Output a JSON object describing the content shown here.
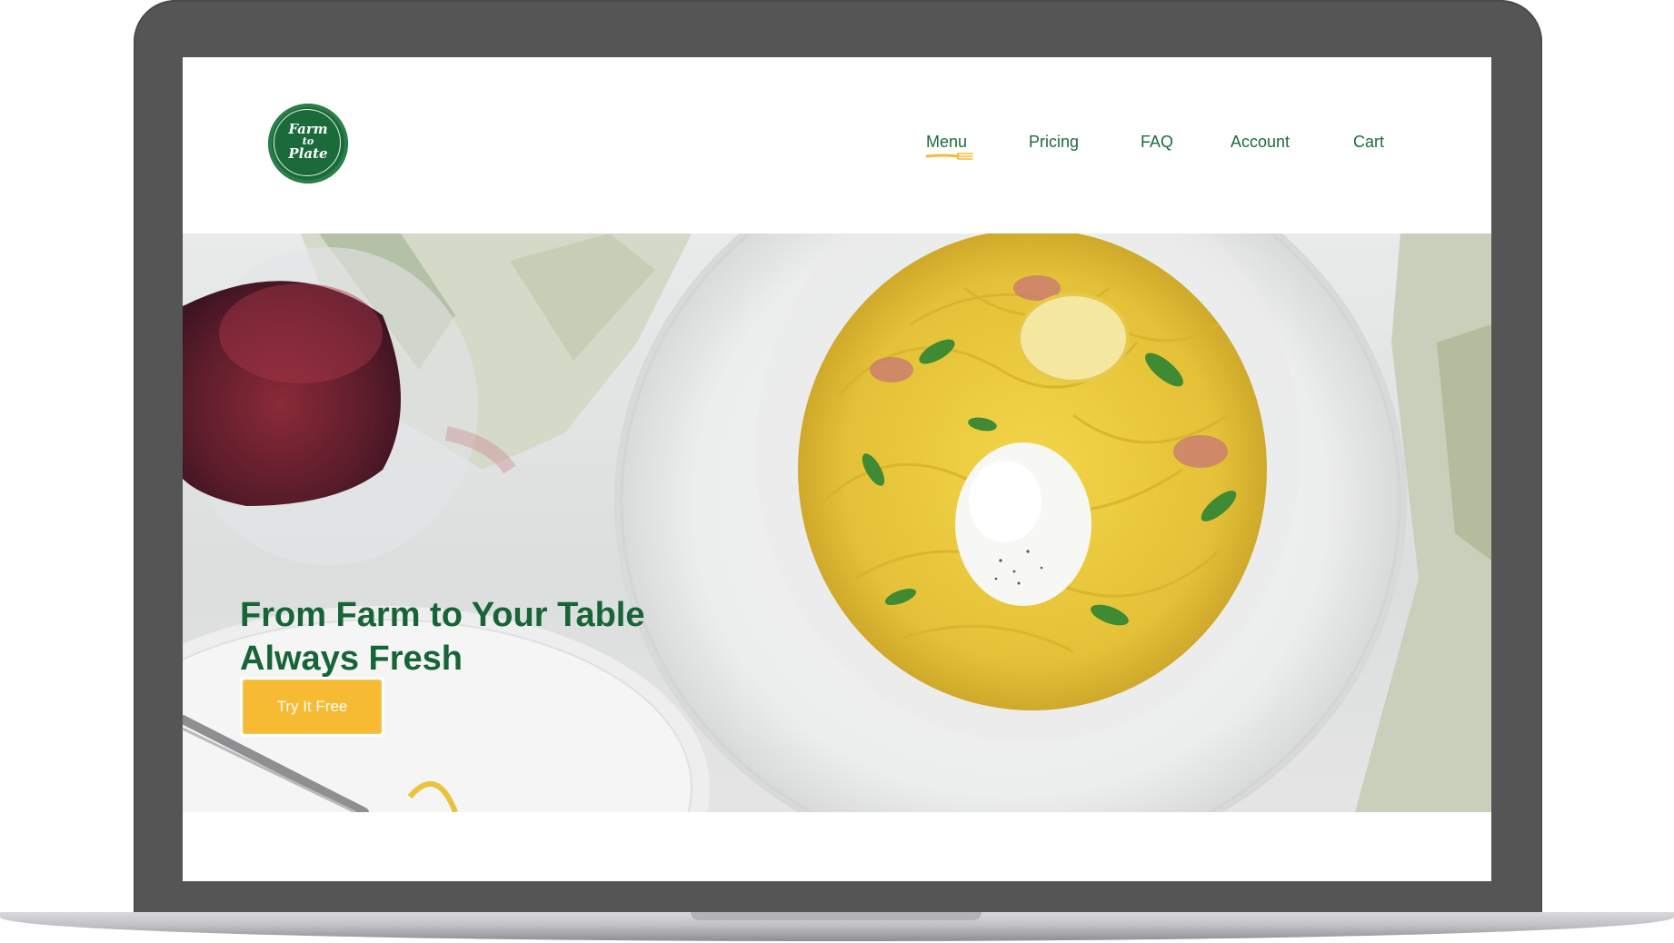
{
  "brand": {
    "logo_line1": "Farm",
    "logo_line2": "to",
    "logo_line3": "Plate",
    "primary_color": "#176437",
    "accent_color": "#f6bb33"
  },
  "nav": {
    "items": [
      {
        "label": "Menu",
        "active": true
      },
      {
        "label": "Pricing",
        "active": false
      },
      {
        "label": "FAQ",
        "active": false
      },
      {
        "label": "Account",
        "active": false
      },
      {
        "label": "Cart",
        "active": false
      }
    ],
    "active_indicator_icon": "fork-icon"
  },
  "hero": {
    "headline_line1": "From Farm to Your Table",
    "headline_line2": "Always Fresh",
    "cta_label": "Try It Free",
    "image": "pasta-dish-with-red-wine-photo"
  }
}
